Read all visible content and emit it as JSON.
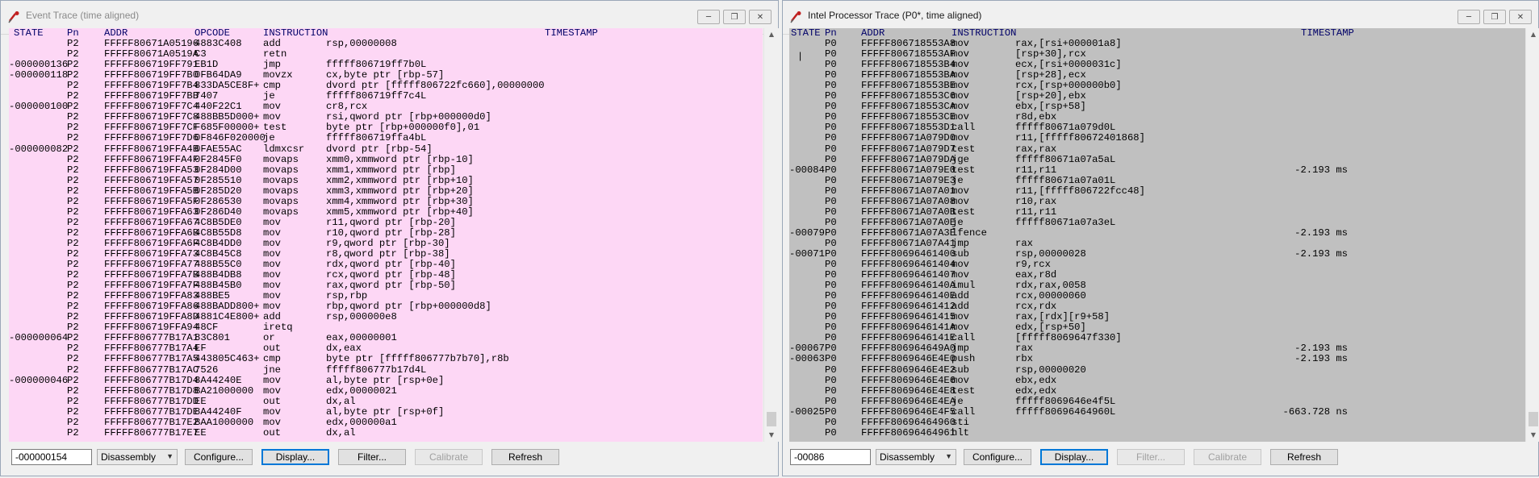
{
  "left": {
    "title": "Event Trace (time aligned)",
    "window_buttons": [
      "minimize",
      "restore",
      "close"
    ],
    "columns": [
      "STATE",
      "Pn",
      "ADDR",
      "OPCODE",
      "INSTRUCTION",
      "TIMESTAMP"
    ],
    "rows": [
      [
        "",
        "P2",
        "FFFFF80671A05196",
        "4883C408",
        "add",
        "rsp,00000008"
      ],
      [
        "",
        "P2",
        "FFFFF80671A0519A",
        "C3",
        "retn",
        ""
      ],
      [
        "-000000136",
        "P2",
        "FFFFF806719FF791",
        "EB1D",
        "jmp",
        "fffff806719ff7b0L"
      ],
      [
        "-000000118",
        "P2",
        "FFFFF806719FF7B0",
        "0FB64DA9",
        "movzx",
        "cx,byte ptr [rbp-57]"
      ],
      [
        "",
        "P2",
        "FFFFF806719FF7B4",
        "833DA5CE8F+",
        "cmp",
        "dvord ptr [fffff806722fc660],00000000"
      ],
      [
        "",
        "P2",
        "FFFFF806719FF7BB",
        "7407",
        "je",
        "fffff806719ff7c4L"
      ],
      [
        "-000000100",
        "P2",
        "FFFFF806719FF7C4",
        "440F22C1",
        "mov",
        "cr8,rcx"
      ],
      [
        "",
        "P2",
        "FFFFF806719FF7C8",
        "488BB5D000+",
        "mov",
        "rsi,qword ptr [rbp+000000d0]"
      ],
      [
        "",
        "P2",
        "FFFFF806719FF7CF",
        "F685F00000+",
        "test",
        "byte ptr [rbp+000000f0],01"
      ],
      [
        "",
        "P2",
        "FFFFF806719FF7D6",
        "0F846F020000",
        "je",
        "fffff806719ffa4bL"
      ],
      [
        "-000000082",
        "P2",
        "FFFFF806719FFA4B",
        "0FAE55AC",
        "ldmxcsr",
        "dvord ptr [rbp-54]"
      ],
      [
        "",
        "P2",
        "FFFFF806719FFA4F",
        "0F2845F0",
        "movaps",
        "xmm0,xmmword ptr [rbp-10]"
      ],
      [
        "",
        "P2",
        "FFFFF806719FFA53",
        "0F284D00",
        "movaps",
        "xmm1,xmmword ptr [rbp]"
      ],
      [
        "",
        "P2",
        "FFFFF806719FFA57",
        "0F285510",
        "movaps",
        "xmm2,xmmword ptr [rbp+10]"
      ],
      [
        "",
        "P2",
        "FFFFF806719FFA5B",
        "0F285D20",
        "movaps",
        "xmm3,xmmword ptr [rbp+20]"
      ],
      [
        "",
        "P2",
        "FFFFF806719FFA5F",
        "0F286530",
        "movaps",
        "xmm4,xmmword ptr [rbp+30]"
      ],
      [
        "",
        "P2",
        "FFFFF806719FFA63",
        "0F286D40",
        "movaps",
        "xmm5,xmmword ptr [rbp+40]"
      ],
      [
        "",
        "P2",
        "FFFFF806719FFA67",
        "4C8B5DE0",
        "mov",
        "r11,qword ptr [rbp-20]"
      ],
      [
        "",
        "P2",
        "FFFFF806719FFA6B",
        "4C8B55D8",
        "mov",
        "r10,qword ptr [rbp-28]"
      ],
      [
        "",
        "P2",
        "FFFFF806719FFA6F",
        "4C8B4DD0",
        "mov",
        "r9,qword ptr [rbp-30]"
      ],
      [
        "",
        "P2",
        "FFFFF806719FFA73",
        "4C8B45C8",
        "mov",
        "r8,qword ptr [rbp-38]"
      ],
      [
        "",
        "P2",
        "FFFFF806719FFA77",
        "488B55C0",
        "mov",
        "rdx,qword ptr [rbp-40]"
      ],
      [
        "",
        "P2",
        "FFFFF806719FFA7B",
        "488B4DB8",
        "mov",
        "rcx,qword ptr [rbp-48]"
      ],
      [
        "",
        "P2",
        "FFFFF806719FFA7F",
        "488B45B0",
        "mov",
        "rax,qword ptr [rbp-50]"
      ],
      [
        "",
        "P2",
        "FFFFF806719FFA83",
        "488BE5",
        "mov",
        "rsp,rbp"
      ],
      [
        "",
        "P2",
        "FFFFF806719FFA86",
        "488BADD800+",
        "mov",
        "rbp,qword ptr [rbp+000000d8]"
      ],
      [
        "",
        "P2",
        "FFFFF806719FFA8D",
        "4881C4E800+",
        "add",
        "rsp,000000e8"
      ],
      [
        "",
        "P2",
        "FFFFF806719FFA94",
        "48CF",
        "iretq",
        ""
      ],
      [
        "-000000064",
        "P2",
        "FFFFF806777B17A1",
        "83C801",
        "or",
        "eax,00000001"
      ],
      [
        "",
        "P2",
        "FFFFF806777B17A4",
        "EF",
        "out",
        "dx,eax"
      ],
      [
        "",
        "P2",
        "FFFFF806777B17A5",
        "443805C463+",
        "cmp",
        "byte ptr [fffff806777b7b70],r8b"
      ],
      [
        "",
        "P2",
        "FFFFF806777B17AC",
        "7526",
        "jne",
        "fffff806777b17d4L"
      ],
      [
        "-000000046",
        "P2",
        "FFFFF806777B17D4",
        "8A44240E",
        "mov",
        "al,byte ptr [rsp+0e]"
      ],
      [
        "",
        "P2",
        "FFFFF806777B17D8",
        "BA21000000",
        "mov",
        "edx,00000021"
      ],
      [
        "",
        "P2",
        "FFFFF806777B17DD",
        "EE",
        "out",
        "dx,al"
      ],
      [
        "",
        "P2",
        "FFFFF806777B17DE",
        "8A44240F",
        "mov",
        "al,byte ptr [rsp+0f]"
      ],
      [
        "",
        "P2",
        "FFFFF806777B17E2",
        "BAA1000000",
        "mov",
        "edx,000000a1"
      ],
      [
        "",
        "P2",
        "FFFFF806777B17E7",
        "EE",
        "out",
        "dx,al"
      ]
    ],
    "bottom": {
      "position_value": "-000000154",
      "view_select": "Disassembly",
      "buttons": [
        "Configure...",
        "Display...",
        "Filter...",
        "Calibrate",
        "Refresh"
      ]
    }
  },
  "right": {
    "title": "Intel Processor Trace (P0*, time aligned)",
    "window_buttons": [
      "minimize",
      "restore",
      "close"
    ],
    "columns": [
      "STATE",
      "Pn",
      "ADDR",
      "INSTRUCTION",
      "TIMESTAMP"
    ],
    "cursor_mark": "|",
    "rows": [
      [
        "",
        "P0",
        "FFFFF806718553A8",
        "mov",
        "rax,[rsi+000001a8]",
        ""
      ],
      [
        "",
        "P0",
        "FFFFF806718553AF",
        "mov",
        "[rsp+30],rcx",
        ""
      ],
      [
        "",
        "P0",
        "FFFFF806718553B4",
        "mov",
        "ecx,[rsi+0000031c]",
        ""
      ],
      [
        "",
        "P0",
        "FFFFF806718553BA",
        "mov",
        "[rsp+28],ecx",
        ""
      ],
      [
        "",
        "P0",
        "FFFFF806718553BE",
        "mov",
        "rcx,[rsp+000000b0]",
        ""
      ],
      [
        "",
        "P0",
        "FFFFF806718553C6",
        "mov",
        "[rsp+20],ebx",
        ""
      ],
      [
        "",
        "P0",
        "FFFFF806718553CA",
        "mov",
        "ebx,[rsp+58]",
        ""
      ],
      [
        "",
        "P0",
        "FFFFF806718553CE",
        "mov",
        "r8d,ebx",
        ""
      ],
      [
        "",
        "P0",
        "FFFFF806718553D1",
        "call",
        "fffff80671a079d0L",
        ""
      ],
      [
        "",
        "P0",
        "FFFFF80671A079D0",
        "mov",
        "r11,[fffff80672401868]",
        ""
      ],
      [
        "",
        "P0",
        "FFFFF80671A079D7",
        "test",
        "rax,rax",
        ""
      ],
      [
        "",
        "P0",
        "FFFFF80671A079DA",
        "jge",
        "fffff80671a07a5aL",
        ""
      ],
      [
        "-00084",
        "P0",
        "FFFFF80671A079E0",
        "test",
        "r11,r11",
        "-2.193 ms"
      ],
      [
        "",
        "P0",
        "FFFFF80671A079E3",
        "je",
        "fffff80671a07a01L",
        ""
      ],
      [
        "",
        "P0",
        "FFFFF80671A07A01",
        "mov",
        "r11,[fffff806722fcc48]",
        ""
      ],
      [
        "",
        "P0",
        "FFFFF80671A07A08",
        "mov",
        "r10,rax",
        ""
      ],
      [
        "",
        "P0",
        "FFFFF80671A07A0B",
        "test",
        "r11,r11",
        ""
      ],
      [
        "",
        "P0",
        "FFFFF80671A07A0E",
        "je",
        "fffff80671a07a3eL",
        ""
      ],
      [
        "-00079",
        "P0",
        "FFFFF80671A07A3E",
        "lfence",
        "",
        "-2.193 ms"
      ],
      [
        "",
        "P0",
        "FFFFF80671A07A41",
        "jmp",
        "rax",
        ""
      ],
      [
        "-00071",
        "P0",
        "FFFFF80696461400",
        "sub",
        "rsp,00000028",
        "-2.193 ms"
      ],
      [
        "",
        "P0",
        "FFFFF80696461404",
        "mov",
        "r9,rcx",
        ""
      ],
      [
        "",
        "P0",
        "FFFFF80696461407",
        "mov",
        "eax,r8d",
        ""
      ],
      [
        "",
        "P0",
        "FFFFF8069646140A",
        "imul",
        "rdx,rax,0058",
        ""
      ],
      [
        "",
        "P0",
        "FFFFF8069646140E",
        "add",
        "rcx,00000060",
        ""
      ],
      [
        "",
        "P0",
        "FFFFF80696461412",
        "add",
        "rcx,rdx",
        ""
      ],
      [
        "",
        "P0",
        "FFFFF80696461415",
        "mov",
        "rax,[rdx][r9+58]",
        ""
      ],
      [
        "",
        "P0",
        "FFFFF8069646141A",
        "mov",
        "edx,[rsp+50]",
        ""
      ],
      [
        "",
        "P0",
        "FFFFF8069646141E",
        "call",
        "[fffff8069647f330]",
        ""
      ],
      [
        "-00067",
        "P0",
        "FFFFF806964649A0",
        "jmp",
        "rax",
        "-2.193 ms"
      ],
      [
        "-00063",
        "P0",
        "FFFFF8069646E4E0",
        "push",
        "rbx",
        "-2.193 ms"
      ],
      [
        "",
        "P0",
        "FFFFF8069646E4E2",
        "sub",
        "rsp,00000020",
        ""
      ],
      [
        "",
        "P0",
        "FFFFF8069646E4E6",
        "mov",
        "ebx,edx",
        ""
      ],
      [
        "",
        "P0",
        "FFFFF8069646E4E8",
        "test",
        "edx,edx",
        ""
      ],
      [
        "",
        "P0",
        "FFFFF8069646E4EA",
        "je",
        "fffff8069646e4f5L",
        ""
      ],
      [
        "-00025",
        "P0",
        "FFFFF8069646E4F5",
        "call",
        "fffff80696464960L",
        "-663.728 ns"
      ],
      [
        "",
        "P0",
        "FFFFF80696464960",
        "sti",
        "",
        ""
      ],
      [
        "",
        "P0",
        "FFFFF80696464961",
        "hlt",
        "",
        ""
      ]
    ],
    "bottom": {
      "position_value": "-00086",
      "view_select": "Disassembly",
      "buttons": [
        "Configure...",
        "Display...",
        "Filter...",
        "Calibrate",
        "Refresh"
      ]
    }
  }
}
